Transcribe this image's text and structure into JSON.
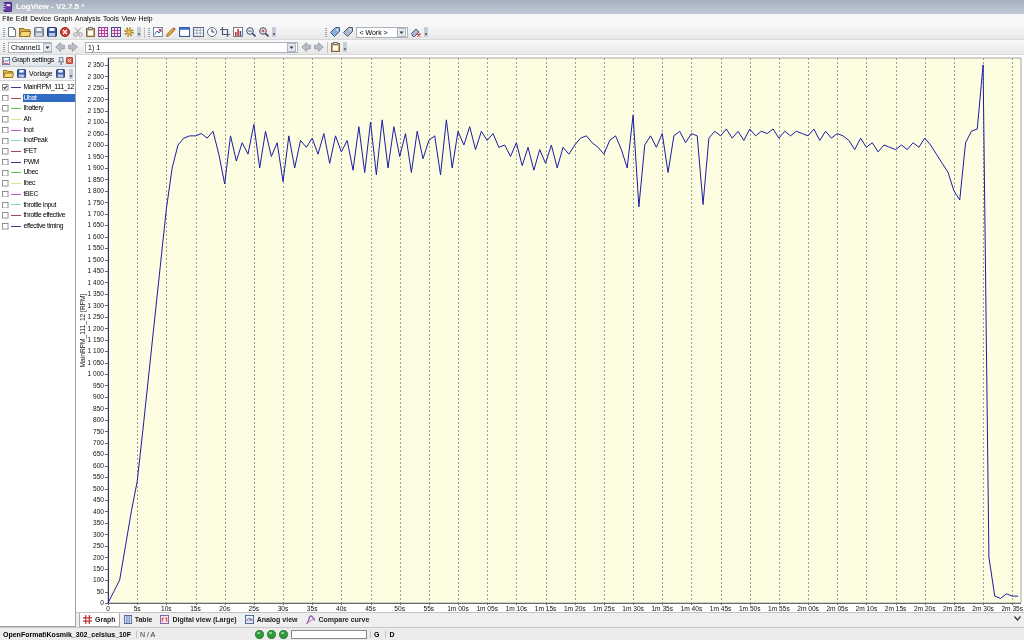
{
  "window": {
    "title": "LogView - V2.7.5 *"
  },
  "menu": [
    "File",
    "Edit",
    "Device",
    "Graph",
    "Analysis",
    "Tools",
    "View",
    "Help"
  ],
  "toolbar": {
    "work_select": {
      "value": "< Work >"
    }
  },
  "channel_bar": {
    "channel_select": {
      "value": "Channel1"
    },
    "series_select": {
      "value": "1) 1"
    }
  },
  "graph_settings": {
    "title": "Graph settings",
    "template_button": "Vorlage",
    "channels": [
      {
        "name": "MainRPM_111_12",
        "checked": true,
        "selected": false,
        "color": "#3c3c8c"
      },
      {
        "name": "Ubat",
        "checked": false,
        "selected": true,
        "color": "#a04848"
      },
      {
        "name": "Ibattery",
        "checked": false,
        "selected": false,
        "color": "#60c060"
      },
      {
        "name": "Ah",
        "checked": false,
        "selected": false,
        "color": "#e8dc8c"
      },
      {
        "name": "Inot",
        "checked": false,
        "selected": false,
        "color": "#c850c8"
      },
      {
        "name": "InotPeak",
        "checked": false,
        "selected": false,
        "color": "#88d8e0"
      },
      {
        "name": "tFET",
        "checked": false,
        "selected": false,
        "color": "#a04848"
      },
      {
        "name": "PWM",
        "checked": false,
        "selected": false,
        "color": "#3c3c8c"
      },
      {
        "name": "Ubec",
        "checked": false,
        "selected": false,
        "color": "#60c060"
      },
      {
        "name": "Ibec",
        "checked": false,
        "selected": false,
        "color": "#e8dc8c"
      },
      {
        "name": "tBEC",
        "checked": false,
        "selected": false,
        "color": "#c850c8"
      },
      {
        "name": "throttle input",
        "checked": false,
        "selected": false,
        "color": "#88d8e0"
      },
      {
        "name": "throttle effective",
        "checked": false,
        "selected": false,
        "color": "#a04848"
      },
      {
        "name": "effective timing",
        "checked": false,
        "selected": false,
        "color": "#3c3c8c"
      }
    ]
  },
  "chart": {
    "chart_data": {
      "type": "line",
      "ylabel": "MainRPM_111_12 [RPM]",
      "grid": true,
      "xlim": [
        0,
        156.5
      ],
      "ylim": [
        0,
        2380
      ],
      "x": [
        0,
        1,
        2,
        3,
        4,
        5,
        6,
        7,
        8,
        9,
        10,
        11,
        12,
        13,
        14,
        15,
        16,
        17,
        18,
        19,
        20,
        21,
        22,
        23,
        24,
        25,
        26,
        27,
        28,
        29,
        30,
        31,
        32,
        33,
        34,
        35,
        36,
        37,
        38,
        39,
        40,
        41,
        42,
        43,
        44,
        45,
        46,
        47,
        48,
        49,
        50,
        51,
        52,
        53,
        54,
        55,
        56,
        57,
        58,
        59,
        60,
        61,
        62,
        63,
        64,
        65,
        66,
        67,
        68,
        69,
        70,
        71,
        72,
        73,
        74,
        75,
        76,
        77,
        78,
        79,
        80,
        81,
        82,
        83,
        84,
        85,
        86,
        87,
        88,
        89,
        90,
        91,
        92,
        93,
        94,
        95,
        96,
        97,
        98,
        99,
        100,
        101,
        102,
        103,
        104,
        105,
        106,
        107,
        108,
        109,
        110,
        111,
        112,
        113,
        114,
        115,
        116,
        117,
        118,
        119,
        120,
        121,
        122,
        123,
        124,
        125,
        126,
        127,
        128,
        129,
        130,
        131,
        132,
        133,
        134,
        135,
        136,
        137,
        138,
        139,
        140,
        141,
        142,
        143,
        144,
        145,
        146,
        147,
        148,
        149,
        150,
        151,
        152,
        153,
        154,
        155,
        156
      ],
      "values": [
        0,
        50,
        100,
        250,
        400,
        530,
        760,
        1000,
        1240,
        1480,
        1720,
        1900,
        2000,
        2030,
        2040,
        2040,
        2050,
        2030,
        2060,
        1960,
        1830,
        2040,
        1930,
        2010,
        1960,
        2090,
        1900,
        2060,
        1950,
        2010,
        1840,
        2040,
        1900,
        2020,
        1990,
        2030,
        1960,
        2050,
        1920,
        2040,
        1970,
        2020,
        1890,
        2080,
        1880,
        2100,
        1870,
        2110,
        1900,
        2080,
        1950,
        2050,
        1880,
        2060,
        1940,
        2020,
        2040,
        1870,
        2110,
        1900,
        2060,
        2000,
        2080,
        1980,
        2060,
        2020,
        2050,
        1990,
        2000,
        1950,
        2010,
        1910,
        1990,
        1890,
        1980,
        1920,
        2000,
        1900,
        1990,
        1960,
        2000,
        2030,
        2040,
        2010,
        1990,
        1960,
        2020,
        2040,
        1980,
        1900,
        2130,
        1730,
        2000,
        2040,
        1990,
        2050,
        1880,
        2040,
        2060,
        2010,
        2050,
        2040,
        1740,
        2030,
        2060,
        2040,
        2070,
        2030,
        2060,
        2020,
        2070,
        2040,
        2060,
        2050,
        2070,
        2030,
        2060,
        2040,
        2060,
        2050,
        2040,
        2070,
        2020,
        2060,
        2030,
        2050,
        2040,
        2020,
        1980,
        2030,
        1990,
        2010,
        1970,
        2000,
        1990,
        1980,
        2000,
        1980,
        2010,
        1990,
        2030,
        2000,
        1960,
        1920,
        1880,
        1800,
        1760,
        2010,
        2060,
        2070,
        2350,
        200,
        30,
        20,
        40,
        30,
        30
      ],
      "xticks": [
        {
          "value": 0,
          "label": "0"
        },
        {
          "value": 5,
          "label": "5s"
        },
        {
          "value": 10,
          "label": "10s"
        },
        {
          "value": 15,
          "label": "15s"
        },
        {
          "value": 20,
          "label": "20s"
        },
        {
          "value": 25,
          "label": "25s"
        },
        {
          "value": 30,
          "label": "30s"
        },
        {
          "value": 35,
          "label": "35s"
        },
        {
          "value": 40,
          "label": "40s"
        },
        {
          "value": 45,
          "label": "45s"
        },
        {
          "value": 50,
          "label": "50s"
        },
        {
          "value": 55,
          "label": "55s"
        },
        {
          "value": 60,
          "label": "1m 00s"
        },
        {
          "value": 65,
          "label": "1m 05s"
        },
        {
          "value": 70,
          "label": "1m 10s"
        },
        {
          "value": 75,
          "label": "1m 15s"
        },
        {
          "value": 80,
          "label": "1m 20s"
        },
        {
          "value": 85,
          "label": "1m 25s"
        },
        {
          "value": 90,
          "label": "1m 30s"
        },
        {
          "value": 95,
          "label": "1m 35s"
        },
        {
          "value": 100,
          "label": "1m 40s"
        },
        {
          "value": 105,
          "label": "1m 45s"
        },
        {
          "value": 110,
          "label": "1m 50s"
        },
        {
          "value": 115,
          "label": "1m 55s"
        },
        {
          "value": 120,
          "label": "2m 00s"
        },
        {
          "value": 125,
          "label": "2m 05s"
        },
        {
          "value": 130,
          "label": "2m 10s"
        },
        {
          "value": 135,
          "label": "2m 15s"
        },
        {
          "value": 140,
          "label": "2m 20s"
        },
        {
          "value": 145,
          "label": "2m 25s"
        },
        {
          "value": 150,
          "label": "2m 30s"
        },
        {
          "value": 155,
          "label": "2m 35s"
        }
      ],
      "yticks": [
        0,
        50,
        100,
        150,
        200,
        250,
        300,
        350,
        400,
        450,
        500,
        550,
        600,
        650,
        700,
        750,
        800,
        850,
        900,
        950,
        {
          "value": 1000,
          "label": "1 000"
        },
        {
          "value": 1050,
          "label": "1 050"
        },
        {
          "value": 1100,
          "label": "1 100"
        },
        {
          "value": 1150,
          "label": "1 150"
        },
        {
          "value": 1200,
          "label": "1 200"
        },
        {
          "value": 1250,
          "label": "1 250"
        },
        {
          "value": 1300,
          "label": "1 300"
        },
        {
          "value": 1350,
          "label": "1 350"
        },
        {
          "value": 1400,
          "label": "1 400"
        },
        {
          "value": 1450,
          "label": "1 450"
        },
        {
          "value": 1500,
          "label": "1 500"
        },
        {
          "value": 1550,
          "label": "1 550"
        },
        {
          "value": 1600,
          "label": "1 600"
        },
        {
          "value": 1650,
          "label": "1 650"
        },
        {
          "value": 1700,
          "label": "1 700"
        },
        {
          "value": 1750,
          "label": "1 750"
        },
        {
          "value": 1800,
          "label": "1 800"
        },
        {
          "value": 1850,
          "label": "1 850"
        },
        {
          "value": 1900,
          "label": "1 900"
        },
        {
          "value": 1950,
          "label": "1 950"
        },
        {
          "value": 2000,
          "label": "2 000"
        },
        {
          "value": 2050,
          "label": "2 050"
        },
        {
          "value": 2100,
          "label": "2 100"
        },
        {
          "value": 2150,
          "label": "2 150"
        },
        {
          "value": 2200,
          "label": "2 200"
        },
        {
          "value": 2250,
          "label": "2 250"
        },
        {
          "value": 2300,
          "label": "2 300"
        },
        {
          "value": 2350,
          "label": "2 350"
        }
      ]
    }
  },
  "tabs": [
    {
      "label": "Graph",
      "selected": true
    },
    {
      "label": "Table",
      "selected": false
    },
    {
      "label": "Digital view (Large)",
      "selected": false
    },
    {
      "label": "Analog view",
      "selected": false
    },
    {
      "label": "Compare curve",
      "selected": false
    }
  ],
  "status_bar": {
    "file": "OpenFormat\\Kosmik_302_celsius_10F",
    "info": "N / A",
    "indicators": [
      "G",
      "D"
    ]
  }
}
